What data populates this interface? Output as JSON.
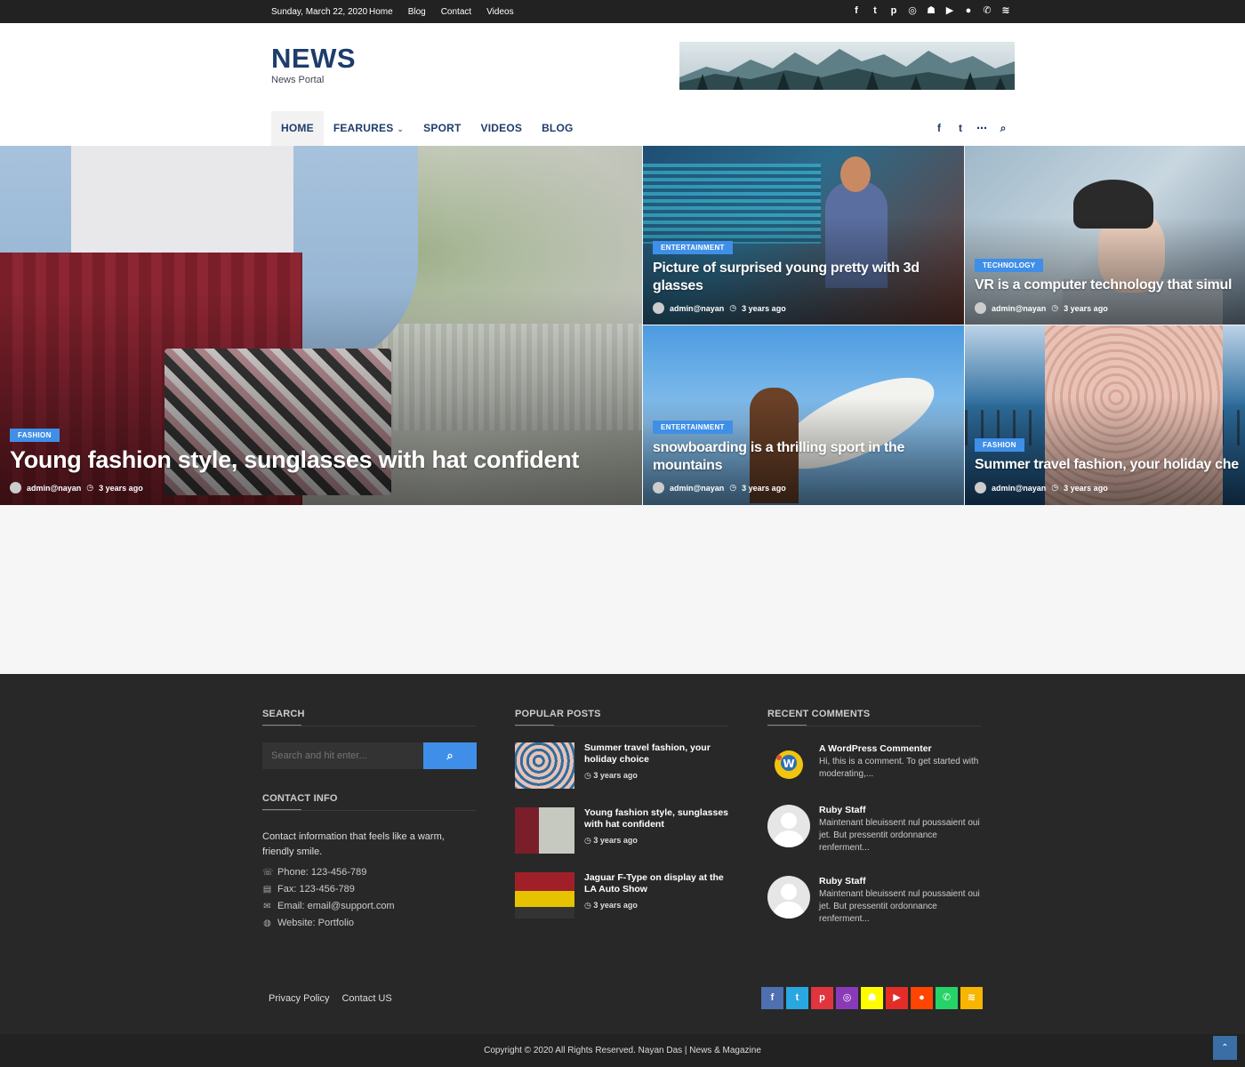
{
  "topbar": {
    "date": "Sunday, March 22, 2020",
    "links": [
      "Home",
      "Blog",
      "Contact",
      "Videos"
    ],
    "social_icons": [
      {
        "name": "facebook-icon",
        "glyph": "f"
      },
      {
        "name": "twitter-icon",
        "glyph": "t"
      },
      {
        "name": "pinterest-icon",
        "glyph": "p"
      },
      {
        "name": "instagram-icon",
        "glyph": "◎"
      },
      {
        "name": "snapchat-icon",
        "glyph": "☗"
      },
      {
        "name": "youtube-icon",
        "glyph": "▶"
      },
      {
        "name": "reddit-icon",
        "glyph": "●"
      },
      {
        "name": "whatsapp-icon",
        "glyph": "✆"
      },
      {
        "name": "rss-icon",
        "glyph": "≋"
      }
    ]
  },
  "header": {
    "logo": "NEWS",
    "tagline": "News Portal",
    "nav": [
      {
        "label": "HOME",
        "active": true,
        "dropdown": false
      },
      {
        "label": "FEARURES",
        "active": false,
        "dropdown": true
      },
      {
        "label": "SPORT",
        "active": false,
        "dropdown": false
      },
      {
        "label": "VIDEOS",
        "active": false,
        "dropdown": false
      },
      {
        "label": "BLOG",
        "active": false,
        "dropdown": false
      }
    ],
    "nav_icons": [
      "facebook-square-icon",
      "twitter-icon",
      "more-icon",
      "search-icon"
    ]
  },
  "hero": [
    {
      "category": "FASHION",
      "title": "Young fashion style, sunglasses with hat confident",
      "author": "admin@nayan",
      "time": "3 years ago"
    },
    {
      "category": "ENTERTAINMENT",
      "title": "Picture of surprised young pretty with 3d glasses",
      "author": "admin@nayan",
      "time": "3 years ago"
    },
    {
      "category": "TECHNOLOGY",
      "title": "VR is a computer technology that simul",
      "author": "admin@nayan",
      "time": "3 years ago"
    },
    {
      "category": "ENTERTAINMENT",
      "title": "snowboarding is a thrilling sport in the mountains",
      "author": "admin@nayan",
      "time": "3 years ago"
    },
    {
      "category": "FASHION",
      "title": "Summer travel fashion, your holiday che",
      "author": "admin@nayan",
      "time": "3 years ago"
    }
  ],
  "footer": {
    "search": {
      "title": "SEARCH",
      "placeholder": "Search and hit enter..."
    },
    "contact": {
      "title": "CONTACT INFO",
      "intro": "Contact information that feels like a warm, friendly smile.",
      "phone": "Phone: 123-456-789",
      "fax": "Fax: 123-456-789",
      "email": "Email: email@support.com",
      "website": "Website: Portfolio"
    },
    "popular": {
      "title": "POPULAR POSTS",
      "items": [
        {
          "title": "Summer travel fashion, your holiday choice",
          "date": "3 years ago"
        },
        {
          "title": "Young fashion style, sunglasses with hat confident",
          "date": "3 years ago"
        },
        {
          "title": "Jaguar F-Type on display at the LA Auto Show",
          "date": "3 years ago"
        }
      ]
    },
    "comments": {
      "title": "RECENT COMMENTS",
      "items": [
        {
          "author": "A WordPress Commenter",
          "text": "Hi, this is a comment. To get started with moderating,..."
        },
        {
          "author": "Ruby Staff",
          "text": "Maintenant bleuissent nul poussaient oui jet. But pressentit ordonnance renferment..."
        },
        {
          "author": "Ruby Staff",
          "text": "Maintenant bleuissent nul poussaient oui jet. But pressentit ordonnance renferment..."
        }
      ]
    },
    "links": [
      "Privacy Policy",
      "Contact US"
    ],
    "social": [
      {
        "name": "facebook-icon",
        "glyph": "f",
        "color": "#4e6fb0"
      },
      {
        "name": "twitter-icon",
        "glyph": "t",
        "color": "#29a7e1"
      },
      {
        "name": "pinterest-icon",
        "glyph": "p",
        "color": "#e0343f"
      },
      {
        "name": "instagram-icon",
        "glyph": "◎",
        "color": "#8a3ab9"
      },
      {
        "name": "snapchat-icon",
        "glyph": "☗",
        "color": "#fffc00"
      },
      {
        "name": "youtube-icon",
        "glyph": "▶",
        "color": "#e52d27"
      },
      {
        "name": "reddit-icon",
        "glyph": "●",
        "color": "#ff4500"
      },
      {
        "name": "whatsapp-icon",
        "glyph": "✆",
        "color": "#25d366"
      },
      {
        "name": "rss-icon",
        "glyph": "≋",
        "color": "#f7b500"
      }
    ],
    "copyright": "Copyright © 2020 All Rights Reserved. Nayan Das | News & Magazine"
  },
  "colors": {
    "brand": "#1d3d6b",
    "accent": "#3f8fe8",
    "footer_bg": "#282828"
  }
}
